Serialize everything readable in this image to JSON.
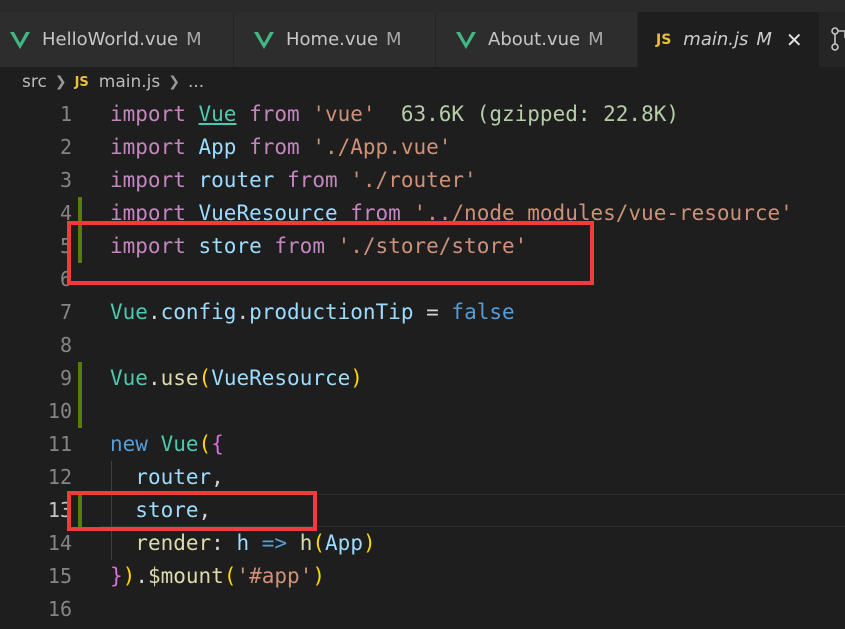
{
  "tabs": [
    {
      "name": "HelloWorld.vue",
      "status": "M"
    },
    {
      "name": "Home.vue",
      "status": "M"
    },
    {
      "name": "About.vue",
      "status": "M"
    },
    {
      "name": "main.js",
      "status": "M",
      "icon": "JS"
    }
  ],
  "breadcrumb": {
    "folder": "src",
    "js_label": "JS",
    "file": "main.js",
    "more": "..."
  },
  "colors": {
    "keyword": "#c586c0",
    "string": "#ce9178",
    "variable": "#9cdcfe",
    "highlight_box": "#f23b3b"
  },
  "lines": [
    {
      "n": "1",
      "t": [
        [
          "kw",
          "import"
        ],
        [
          "p",
          " "
        ],
        [
          "cls u",
          "Vue"
        ],
        [
          "p",
          " "
        ],
        [
          "kw",
          "from"
        ],
        [
          "p",
          " "
        ],
        [
          "str",
          "'vue'"
        ],
        [
          "p",
          "  "
        ],
        [
          "hint",
          "63.6K (gzipped: 22.8K)"
        ]
      ]
    },
    {
      "n": "2",
      "t": [
        [
          "kw",
          "import"
        ],
        [
          "p",
          " "
        ],
        [
          "id",
          "App"
        ],
        [
          "p",
          " "
        ],
        [
          "kw",
          "from"
        ],
        [
          "p",
          " "
        ],
        [
          "str",
          "'./App.vue'"
        ]
      ]
    },
    {
      "n": "3",
      "t": [
        [
          "kw",
          "import"
        ],
        [
          "p",
          " "
        ],
        [
          "id",
          "router"
        ],
        [
          "p",
          " "
        ],
        [
          "kw",
          "from"
        ],
        [
          "p",
          " "
        ],
        [
          "str",
          "'./router'"
        ]
      ]
    },
    {
      "n": "4",
      "t": [
        [
          "kw",
          "import"
        ],
        [
          "p",
          " "
        ],
        [
          "id",
          "VueResource"
        ],
        [
          "p",
          " "
        ],
        [
          "kw",
          "from"
        ],
        [
          "p",
          " "
        ],
        [
          "str",
          "'../node_modules/vue-resource'"
        ]
      ]
    },
    {
      "n": "5",
      "t": [
        [
          "kw",
          "import"
        ],
        [
          "p",
          " "
        ],
        [
          "id",
          "store"
        ],
        [
          "p",
          " "
        ],
        [
          "kw",
          "from"
        ],
        [
          "p",
          " "
        ],
        [
          "str",
          "'./store/store'"
        ]
      ]
    },
    {
      "n": "6",
      "t": []
    },
    {
      "n": "7",
      "t": [
        [
          "cls",
          "Vue"
        ],
        [
          "p",
          "."
        ],
        [
          "id",
          "config"
        ],
        [
          "p",
          "."
        ],
        [
          "id",
          "productionTip"
        ],
        [
          "p",
          " = "
        ],
        [
          "bool",
          "false"
        ]
      ]
    },
    {
      "n": "8",
      "t": []
    },
    {
      "n": "9",
      "t": [
        [
          "cls",
          "Vue"
        ],
        [
          "p",
          "."
        ],
        [
          "fn",
          "use"
        ],
        [
          "br1",
          "("
        ],
        [
          "id",
          "VueResource"
        ],
        [
          "br1",
          ")"
        ]
      ]
    },
    {
      "n": "10",
      "t": []
    },
    {
      "n": "11",
      "t": [
        [
          "bool",
          "new"
        ],
        [
          "p",
          " "
        ],
        [
          "cls",
          "Vue"
        ],
        [
          "br1",
          "("
        ],
        [
          "br2",
          "{"
        ]
      ]
    },
    {
      "n": "12",
      "t": [
        [
          "p",
          "  "
        ],
        [
          "id",
          "router"
        ],
        [
          "p",
          ","
        ]
      ]
    },
    {
      "n": "13",
      "t": [
        [
          "p",
          "  "
        ],
        [
          "id",
          "store"
        ],
        [
          "p",
          ","
        ]
      ]
    },
    {
      "n": "14",
      "t": [
        [
          "p",
          "  "
        ],
        [
          "fn",
          "render"
        ],
        [
          "p",
          ": "
        ],
        [
          "id",
          "h"
        ],
        [
          "p",
          " "
        ],
        [
          "bool",
          "=>"
        ],
        [
          "p",
          " "
        ],
        [
          "fn",
          "h"
        ],
        [
          "br1",
          "("
        ],
        [
          "id",
          "App"
        ],
        [
          "br1",
          ")"
        ]
      ]
    },
    {
      "n": "15",
      "t": [
        [
          "br2",
          "}"
        ],
        [
          "br1",
          ")"
        ],
        [
          "p",
          "."
        ],
        [
          "fn",
          "$mount"
        ],
        [
          "br1",
          "("
        ],
        [
          "str",
          "'#app'"
        ],
        [
          "br1",
          ")"
        ]
      ]
    },
    {
      "n": "16",
      "t": []
    }
  ]
}
